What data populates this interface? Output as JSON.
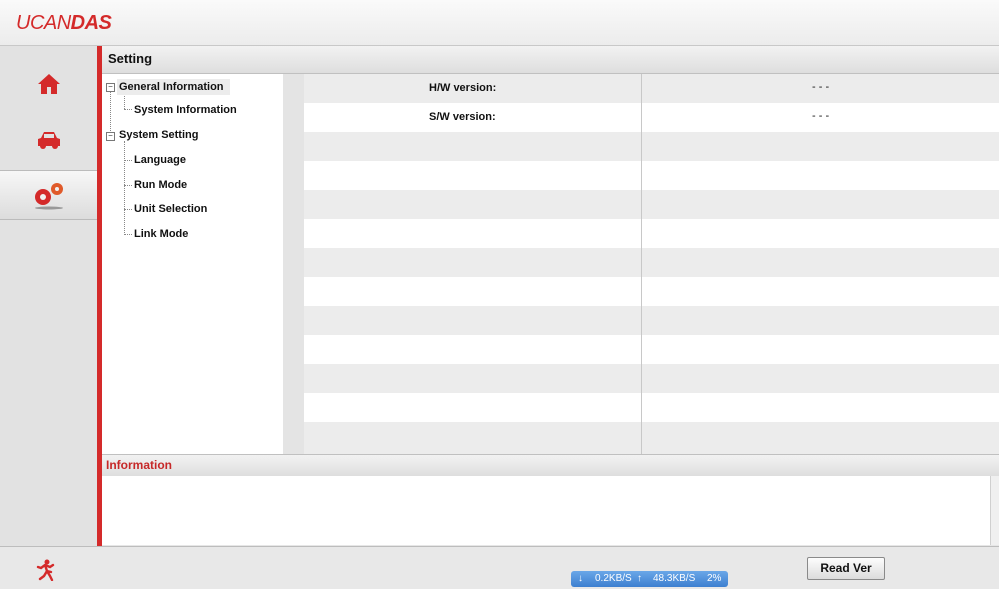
{
  "app": {
    "logo_light": "UCAN",
    "logo_bold": "DAS"
  },
  "nav": {
    "items": [
      {
        "name": "home",
        "icon": "home-icon"
      },
      {
        "name": "vehicle",
        "icon": "car-icon"
      },
      {
        "name": "settings",
        "icon": "gears-icon",
        "active": true
      }
    ]
  },
  "page": {
    "title": "Setting"
  },
  "tree": {
    "general": "General Information",
    "system_information": "System Information",
    "system_setting": "System Setting",
    "language": "Language",
    "run_mode": "Run Mode",
    "unit_selection": "Unit Selection",
    "link_mode": "Link Mode"
  },
  "grid": {
    "rows": [
      {
        "label": "H/W version:",
        "value": "- - -"
      },
      {
        "label": "S/W version:",
        "value": "- - -"
      }
    ]
  },
  "info": {
    "title": "Information"
  },
  "footer": {
    "read_ver": "Read Ver",
    "net_down": "0.2KB/S",
    "net_up": "48.3KB/S",
    "net_pct": "2%"
  },
  "colors": {
    "accent": "#d42a2a"
  }
}
